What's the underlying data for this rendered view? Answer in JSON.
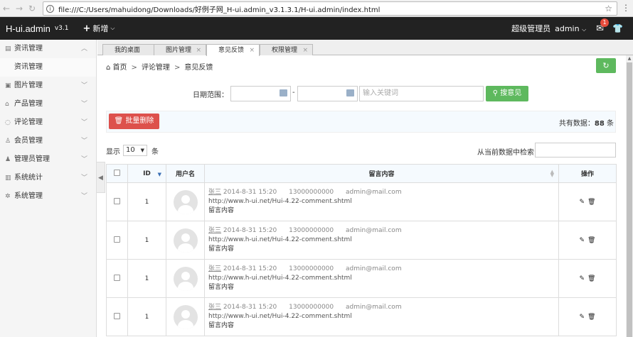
{
  "browser": {
    "url": "file:///C:/Users/mahuidong/Downloads/好例子网_H-ui.admin_v3.1.3.1/H-ui.admin/index.html"
  },
  "header": {
    "logo": "H-ui.admin",
    "version": "v3.1",
    "add_label": "新增",
    "role": "超级管理员",
    "user": "admin",
    "msg_count": "1"
  },
  "sidebar": {
    "items": [
      {
        "label": "资讯管理",
        "icon": "news-icon"
      },
      {
        "label": "资讯管理",
        "icon": ""
      },
      {
        "label": "图片管理",
        "icon": "image-icon"
      },
      {
        "label": "产品管理",
        "icon": "product-icon"
      },
      {
        "label": "评论管理",
        "icon": "comment-icon"
      },
      {
        "label": "会员管理",
        "icon": "member-icon"
      },
      {
        "label": "管理员管理",
        "icon": "admin-icon"
      },
      {
        "label": "系统统计",
        "icon": "chart-icon"
      },
      {
        "label": "系统管理",
        "icon": "gear-icon"
      }
    ]
  },
  "tabs": [
    {
      "label": "我的桌面"
    },
    {
      "label": "图片管理"
    },
    {
      "label": "意见反馈"
    },
    {
      "label": "权限管理"
    }
  ],
  "breadcrumb": {
    "home": "首页",
    "level1": "评论管理",
    "level2": "意见反馈"
  },
  "search": {
    "date_label": "日期范围：",
    "dash": "-",
    "keyword_placeholder": "输入关键词",
    "button": "搜意见"
  },
  "actions": {
    "batch_delete": "批量删除",
    "total_prefix": "共有数据：",
    "total_count": "88",
    "total_suffix": " 条"
  },
  "length": {
    "prefix": "显示",
    "value": "10",
    "suffix": "条"
  },
  "filter": {
    "label": "从当前数据中检索:"
  },
  "table": {
    "headers": {
      "id": "ID",
      "user": "用户名",
      "content": "留言内容",
      "ops": "操作"
    },
    "rows": [
      {
        "id": "1",
        "name": "张三",
        "time": "2014-8-31 15:20",
        "phone": "13000000000",
        "email": "admin@mail.com",
        "url": "http://www.h-ui.net/Hui-4.22-comment.shtml",
        "text": "留言内容"
      },
      {
        "id": "1",
        "name": "张三",
        "time": "2014-8-31 15:20",
        "phone": "13000000000",
        "email": "admin@mail.com",
        "url": "http://www.h-ui.net/Hui-4.22-comment.shtml",
        "text": "留言内容"
      },
      {
        "id": "1",
        "name": "张三",
        "time": "2014-8-31 15:20",
        "phone": "13000000000",
        "email": "admin@mail.com",
        "url": "http://www.h-ui.net/Hui-4.22-comment.shtml",
        "text": "留言内容"
      },
      {
        "id": "1",
        "name": "张三",
        "time": "2014-8-31 15:20",
        "phone": "13000000000",
        "email": "admin@mail.com",
        "url": "http://www.h-ui.net/Hui-4.22-comment.shtml",
        "text": "留言内容"
      }
    ]
  },
  "colors": {
    "green": "#5eb95e",
    "red": "#dd514c",
    "header_bg": "#222222"
  }
}
